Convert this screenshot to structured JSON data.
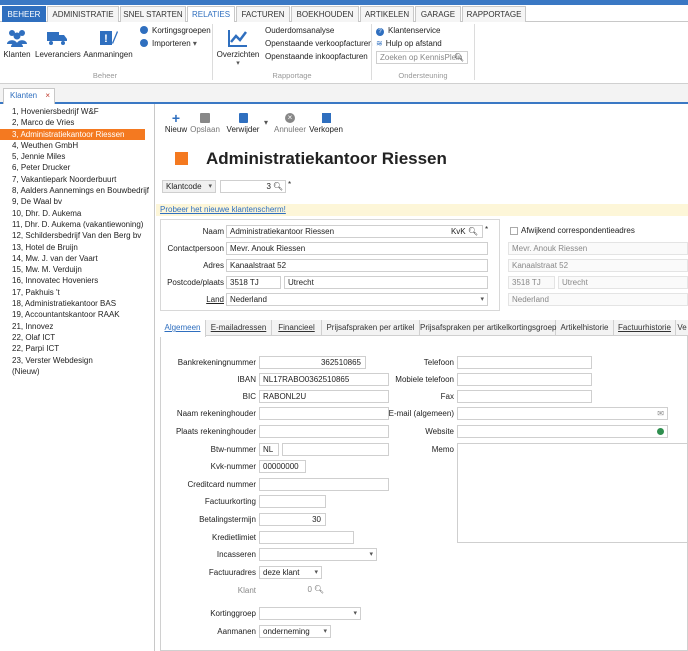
{
  "ribbon_tabs": [
    "BEHEER",
    "ADMINISTRATIE",
    "SNEL STARTEN",
    "RELATIES",
    "FACTUREN",
    "BOEKHOUDEN",
    "ARTIKELEN",
    "GARAGE",
    "RAPPORTAGE"
  ],
  "ribbon": {
    "klanten": "Klanten",
    "leveranciers": "Leveranciers",
    "aanmaningen": "Aanmaningen",
    "kortingsgroepen": "Kortingsgroepen",
    "importeren": "Importeren",
    "beheer_caption": "Beheer",
    "overzichten": "Overzichten",
    "ouderdomsanalyse": "Ouderdomsanalyse",
    "verkoopfacturen": "Openstaande verkoopfacturen",
    "inkoopfacturen": "Openstaande inkoopfacturen",
    "rapportage_caption": "Rapportage",
    "klantenservice": "Klantenservice",
    "hulp": "Hulp op afstand",
    "search_placeholder": "Zoeken op KennisPlein",
    "ondersteuning_caption": "Ondersteuning"
  },
  "doc_tab": "Klanten",
  "clients": [
    "1, Hoveniersbedrijf W&F",
    "2, Marco de Vries",
    "3, Administratiekantoor Riessen",
    "4, Weuthen GmbH",
    "5, Jennie Miles",
    "6, Peter Drucker",
    "7, Vakantiepark Noorderbuurt",
    "8, Aalders  Aannemings en Bouwbedrijf",
    "9, De Waal bv",
    "10, Dhr. D. Aukema",
    "11, Dhr. D. Aukema (vakantiewoning)",
    "12, Schildersbedrijf Van den Berg bv",
    "13, Hotel de Bruijn",
    "14, Mw. J. van der Vaart",
    "15, Mw. M. Verduijn",
    "16, Innovatec Hoveniers",
    "17, Pakhuis 't",
    "18, Administratiekantoor BAS",
    "19, Accountantskantoor RAAK",
    "21, Innovez",
    "22, Olaf ICT",
    "22, Parpi ICT",
    "23, Verster Webdesign",
    "(Nieuw)"
  ],
  "toolbar": {
    "nieuw": "Nieuw",
    "opslaan": "Opslaan",
    "verwijder": "Verwijder",
    "annuleer": "Annuleer",
    "verkopen": "Verkopen"
  },
  "title": "Administratiekantoor Riessen",
  "klantcode": {
    "label": "Klantcode",
    "value": "3"
  },
  "new_screen_link": "Probeer het nieuwe klantenscherm!",
  "contact": {
    "naam_label": "Naam",
    "naam": "Administratiekantoor Riessen",
    "kvk": "KvK",
    "contact_label": "Contactpersoon",
    "contact": "Mevr. Anouk Riessen",
    "adres_label": "Adres",
    "adres": "Kanaalstraat 52",
    "postcode_label": "Postcode/plaats",
    "postcode": "3518 TJ",
    "plaats": "Utrecht",
    "land_label": "Land",
    "land": "Nederland"
  },
  "corr": {
    "label": "Afwijkend correspondentieadres",
    "contact": "Mevr. Anouk Riessen",
    "adres": "Kanaalstraat 52",
    "postcode": "3518 TJ",
    "plaats": "Utrecht",
    "land": "Nederland"
  },
  "page_tabs": [
    "Algemeen",
    "E-mailadressen",
    "Financieel",
    "Prijsafspraken per artikel",
    "Prijsafspraken per artikelkortingsgroep",
    "Artikelhistorie",
    "Factuurhistorie",
    "Ve"
  ],
  "general": {
    "bank_label": "Bankrekeningnummer",
    "bank": "362510865",
    "iban_label": "IBAN",
    "iban": "NL17RABO0362510865",
    "bic_label": "BIC",
    "bic": "RABONL2U",
    "naamrek_label": "Naam rekeninghouder",
    "plaatsrek_label": "Plaats rekeninghouder",
    "btw_label": "Btw-nummer",
    "btw_prefix": "NL",
    "kvk_label": "Kvk-nummer",
    "kvk": "00000000",
    "cc_label": "Creditcard nummer",
    "factuurkorting_label": "Factuurkorting",
    "betaling_label": "Betalingstermijn",
    "betaling": "30",
    "krediet_label": "Kredietlimiet",
    "incasseren_label": "Incasseren",
    "factuuradres_label": "Factuuradres",
    "factuuradres": "deze klant",
    "klant_label": "Klant",
    "klant": "0",
    "kortinggroep_label": "Kortinggroep",
    "aanmanen_label": "Aanmanen",
    "aanmanen": "onderneming",
    "telefoon_label": "Telefoon",
    "mobiel_label": "Mobiele telefoon",
    "fax_label": "Fax",
    "email_label": "E-mail (algemeen)",
    "website_label": "Website",
    "memo_label": "Memo"
  },
  "colors": {
    "accent": "#f47920",
    "ribbon_blue": "#2f6fbf"
  }
}
